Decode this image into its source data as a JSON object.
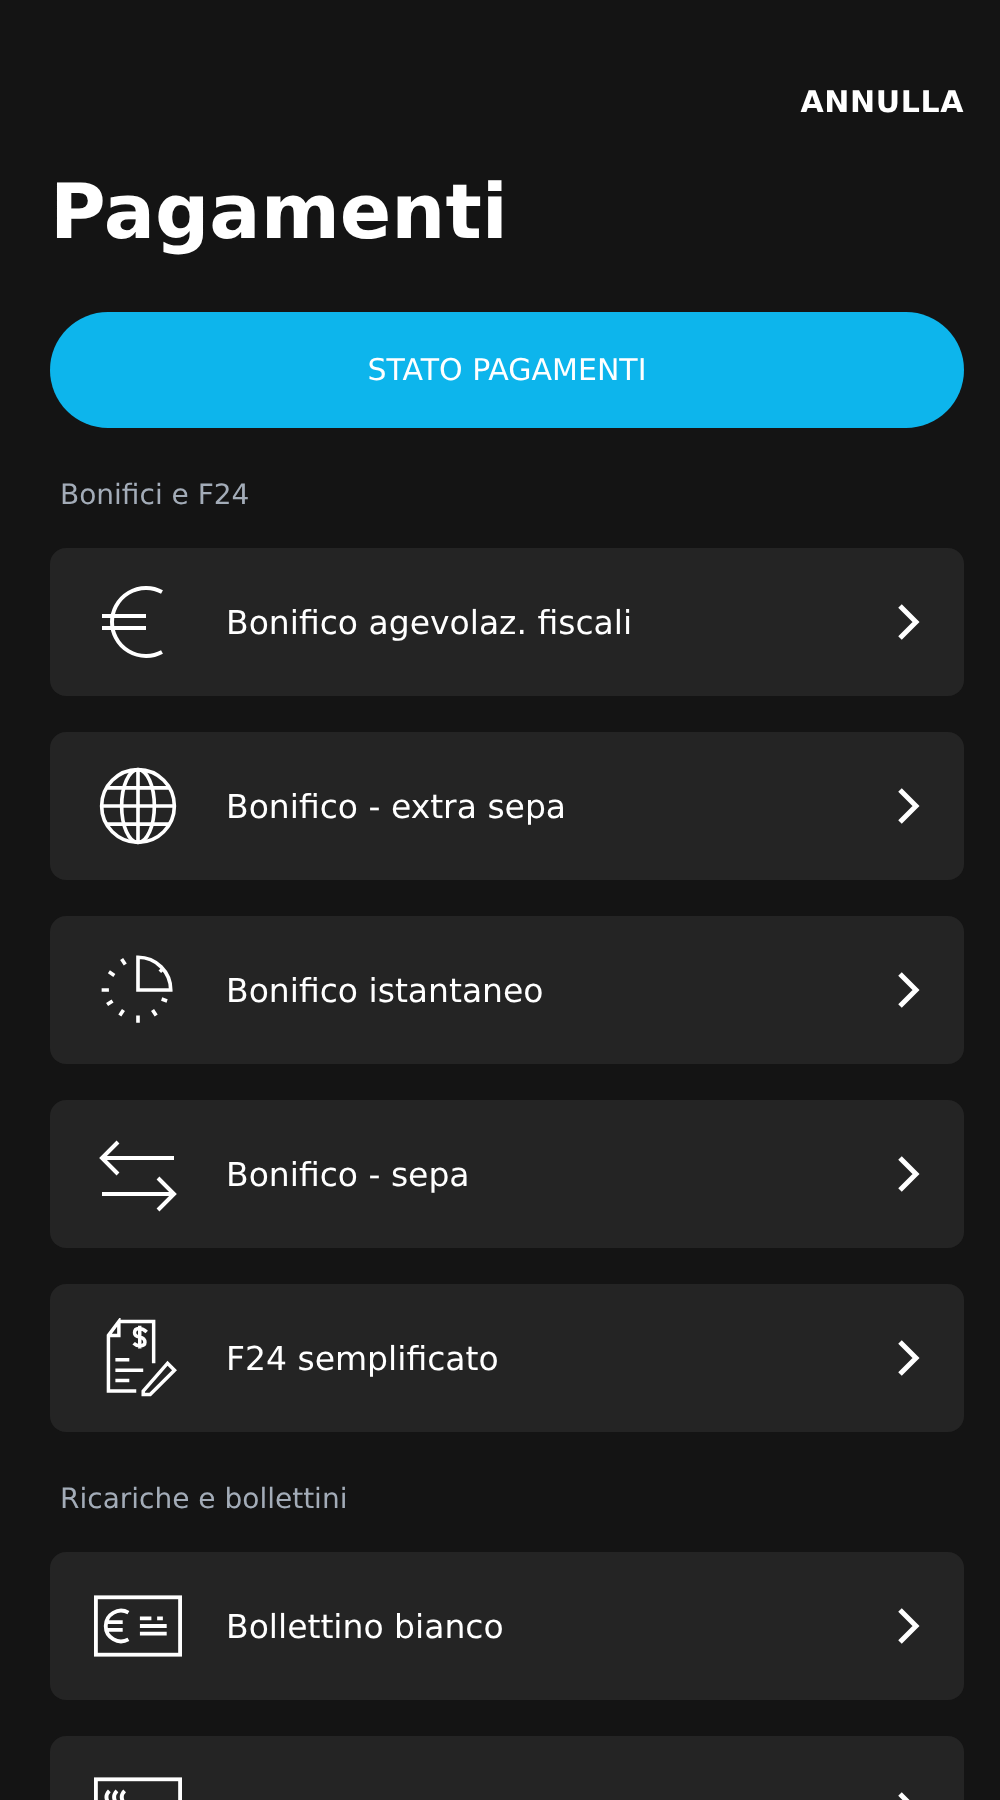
{
  "header": {
    "cancel": "ANNULLA",
    "title": "Pagamenti"
  },
  "status_button": "STATO PAGAMENTI",
  "sections": [
    {
      "title": "Bonifici e F24",
      "items": [
        {
          "kind": "euro",
          "label": "Bonifico agevolaz. fiscali"
        },
        {
          "kind": "globe",
          "label": "Bonifico - extra sepa"
        },
        {
          "kind": "timer",
          "label": "Bonifico istantaneo"
        },
        {
          "kind": "arrows",
          "label": "Bonifico - sepa"
        },
        {
          "kind": "document",
          "label": "F24 semplificato"
        }
      ]
    },
    {
      "title": "Ricariche e bollettini",
      "items": [
        {
          "kind": "slip",
          "label": "Bollettino bianco"
        },
        {
          "kind": "card"
        }
      ]
    }
  ]
}
